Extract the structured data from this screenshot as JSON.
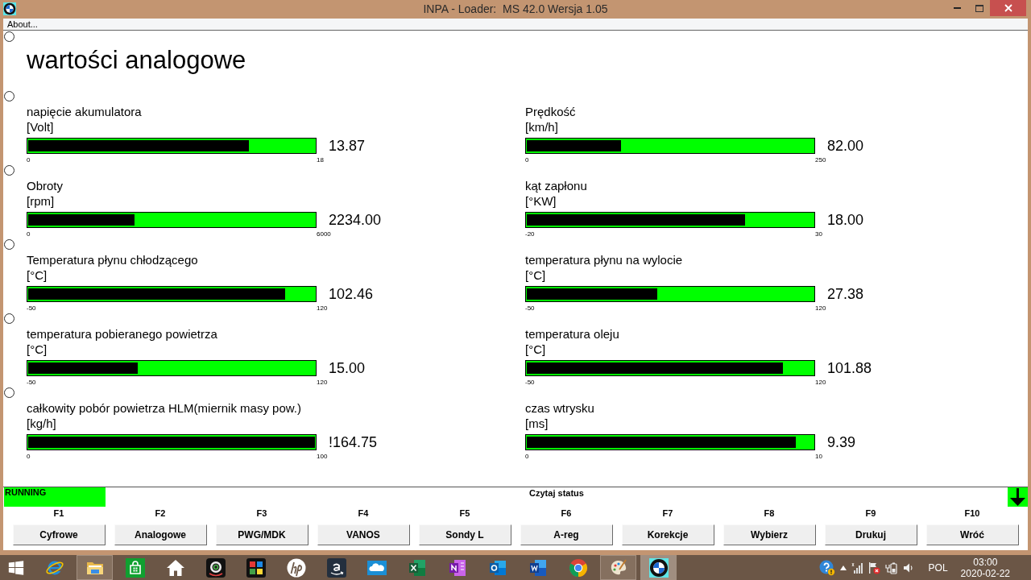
{
  "window": {
    "title": "INPA - Loader:  MS 42.0 Wersja 1.05"
  },
  "menu": [
    {
      "label": "About..."
    }
  ],
  "page_title": "wartości analogowe",
  "markers": [
    {
      "selected": false
    },
    {
      "selected": false
    },
    {
      "selected": false
    },
    {
      "selected": false
    },
    {
      "selected": false
    },
    {
      "selected": false
    }
  ],
  "gauges": [
    {
      "label": "napięcie akumulatora",
      "unit": "[Volt]",
      "min": "0",
      "max": "18",
      "value": "13.87",
      "level": 0.771
    },
    {
      "label": "Prędkość",
      "unit": "[km/h]",
      "min": "0",
      "max": "250",
      "value": "82.00",
      "level": 0.328
    },
    {
      "label": "Obroty",
      "unit": "[rpm]",
      "min": "0",
      "max": "6000",
      "value": "2234.00",
      "level": 0.372
    },
    {
      "label": "kąt zapłonu",
      "unit": "[°KW]",
      "min": "-20",
      "max": "30",
      "value": "18.00",
      "level": 0.76
    },
    {
      "label": "Temperatura płynu chłodzącego",
      "unit": "[°C]",
      "min": "-50",
      "max": "120",
      "value": "102.46",
      "level": 0.897
    },
    {
      "label": "temperatura płynu na wylocie",
      "unit": "[°C]",
      "min": "-50",
      "max": "120",
      "value": "27.38",
      "level": 0.455
    },
    {
      "label": "temperatura pobieranego powietrza",
      "unit": "[°C]",
      "min": "-50",
      "max": "120",
      "value": "15.00",
      "level": 0.382
    },
    {
      "label": "temperatura oleju",
      "unit": "[°C]",
      "min": "-50",
      "max": "120",
      "value": "101.88",
      "level": 0.893
    },
    {
      "label": "całkowity pobór powietrza HLM(miernik masy pow.)",
      "unit": "[kg/h]",
      "min": "0",
      "max": "100",
      "value": "!164.75",
      "level": 1
    },
    {
      "label": "czas wtrysku",
      "unit": "[ms]",
      "min": "0",
      "max": "10",
      "value": "9.39",
      "level": 0.939
    }
  ],
  "status_bar": {
    "state": "RUNNING",
    "on": true,
    "caption": "Czytaj status",
    "indicator_on": true
  },
  "function_keys": [
    {
      "key": "F1",
      "label": "Cyfrowe"
    },
    {
      "key": "F2",
      "label": "Analogowe"
    },
    {
      "key": "F3",
      "label": "PWG/MDK"
    },
    {
      "key": "F4",
      "label": "VANOS"
    },
    {
      "key": "F5",
      "label": "Sondy L"
    },
    {
      "key": "F6",
      "label": "A-reg"
    },
    {
      "key": "F7",
      "label": "Korekcje"
    },
    {
      "key": "F8",
      "label": "Wybierz"
    },
    {
      "key": "F9",
      "label": "Drukuj"
    },
    {
      "key": "F10",
      "label": "Wróć"
    }
  ],
  "taskbar": {
    "apps": [
      {
        "kind": "start",
        "running": false,
        "selected": false
      },
      {
        "kind": "browser_e",
        "running": false,
        "selected": false
      },
      {
        "kind": "folder",
        "running": true,
        "selected": false
      },
      {
        "kind": "store",
        "running": false,
        "selected": false
      },
      {
        "kind": "home",
        "running": false,
        "selected": false
      },
      {
        "kind": "camera",
        "running": false,
        "selected": false
      },
      {
        "kind": "puzzle",
        "running": false,
        "selected": false
      },
      {
        "kind": "circle_logo",
        "running": false,
        "selected": false
      },
      {
        "kind": "smile_logo",
        "running": false,
        "selected": false
      },
      {
        "kind": "cloud",
        "running": false,
        "selected": false
      },
      {
        "kind": "spreadsheet",
        "running": false,
        "selected": false
      },
      {
        "kind": "notebook",
        "running": false,
        "selected": false
      },
      {
        "kind": "mail",
        "running": false,
        "selected": false
      },
      {
        "kind": "document",
        "running": false,
        "selected": false
      },
      {
        "kind": "browser_circle",
        "running": false,
        "selected": false
      },
      {
        "kind": "palette",
        "running": true,
        "selected": false
      },
      {
        "kind": "roundel",
        "running": true,
        "selected": true
      }
    ],
    "tray": {
      "icons": [
        {
          "kind": "help"
        },
        {
          "kind": "caret"
        },
        {
          "kind": "signal"
        },
        {
          "kind": "flag"
        },
        {
          "kind": "battery"
        },
        {
          "kind": "speaker"
        }
      ],
      "language": "POL",
      "time": "03:00",
      "date": "2020-02-22"
    }
  }
}
